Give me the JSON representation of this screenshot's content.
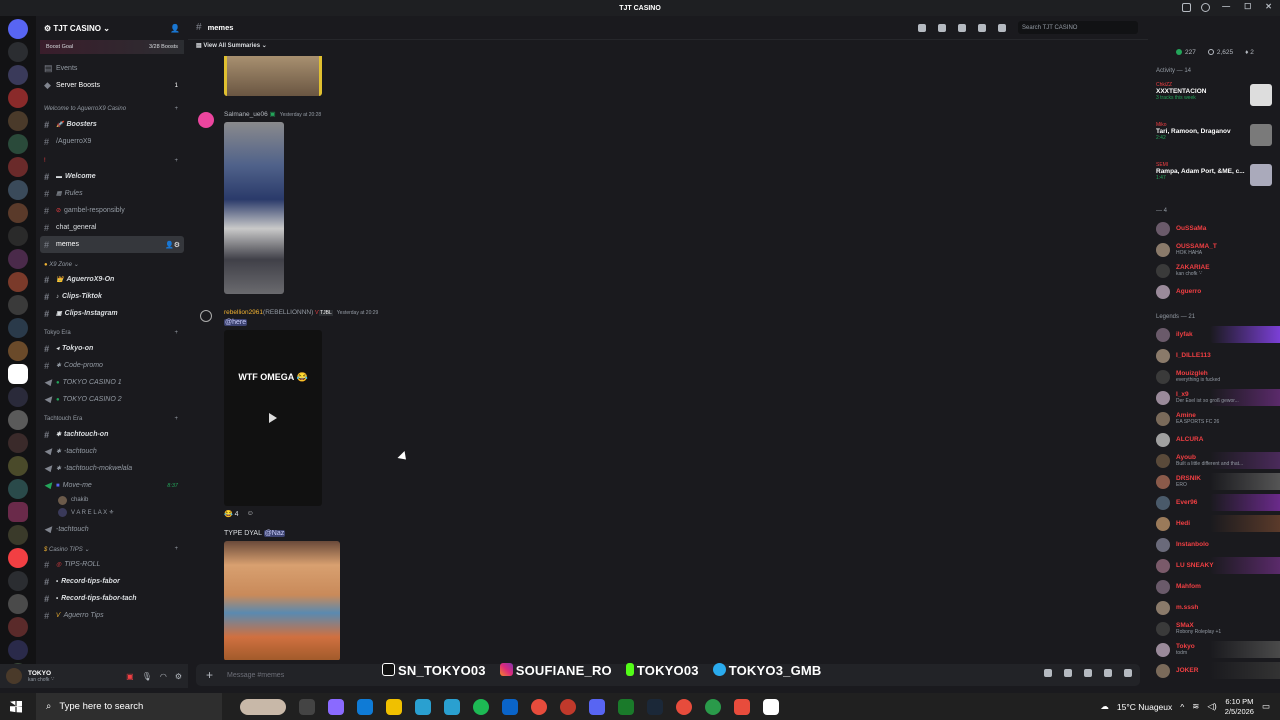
{
  "window": {
    "title": "TJT CASINO"
  },
  "server": {
    "name": "TJT CASINO",
    "boost_goal": "Boost Goal",
    "boost_count": "3/28 Boosts"
  },
  "channels": {
    "events": "Events",
    "server_boosts": "Server Boosts",
    "server_boosts_count": "1",
    "cat1": "Welcome to AguerroX9 Casino",
    "boosters": "Boosters",
    "aguerro": "/AguerroX9",
    "cat2": "!",
    "welcome": "Welcome",
    "rules": "Rules",
    "gambel": "gambel-responsibly",
    "chat_general": "chat_general",
    "memes": "memes",
    "cat3": "X9 Zone",
    "aguerro_on": "AguerroX9-On",
    "clips_tiktok": "Clips-Tiktok",
    "clips_instagram": "Clips-Instagram",
    "cat4": "Tokyo Era",
    "tokyo_on": "Tokyo-on",
    "code_promo": "Code-promo",
    "tokyo_casino1": "TOKYO CASINO 1",
    "tokyo_casino2": "TOKYO CASINO 2",
    "cat5": "Tachtouch Era",
    "tachtouch_on": "tachtouch-on",
    "tachtouch": "-tachtouch",
    "tachtouch_mok": "-tachtouch-mokwelala",
    "move_me": "Move-me",
    "move_me_time": "8:37",
    "vc_user1": "chakib",
    "vc_user2": "V A R E L A X ⚜",
    "tachtouch2": "-tachtouch",
    "cat6": "Casino TIPS",
    "tips_roll": "TIPS-ROLL",
    "record_fabor": "Record-tips-fabor",
    "record_fabor_tach": "Record-tips-fabor-tach",
    "aguerro_tips": "Aguerro Tips"
  },
  "user": {
    "name": "TOKYO",
    "status": "kan chofk '-'"
  },
  "channel_header": {
    "name": "memes",
    "search_placeholder": "Search TJT CASINO"
  },
  "summaries": "View All Summaries",
  "messages": [
    {
      "author": "Salmane_ue06",
      "time": "Yesterday at 20:28"
    },
    {
      "author": "rebellion2961",
      "alias": "(REBELLIONNN)",
      "tag": "TJBL",
      "time": "Yesterday at 20:29",
      "mention": "@here",
      "video_text": "WTF OMEGA 😂",
      "reaction_count": "4"
    },
    {
      "text": "TYPE DYAL",
      "mention": "@Naz"
    }
  ],
  "composer": {
    "placeholder": "Message #memes"
  },
  "overlay": {
    "tiktok": "SN_TOKYO03",
    "instagram": "SOUFIANE_RO",
    "kick": "TOKYO03",
    "telegram": "TOKYO3_GMB"
  },
  "right": {
    "online": "227",
    "members": "2,625",
    "boosts": "2",
    "activity_title": "Activity — 14",
    "activities": [
      {
        "who": "ChkiZZ",
        "title": "XXXTENTACION",
        "sub": "3 tracks this week"
      },
      {
        "who": "Miko",
        "title": "Tari, Ramoon, Draganov",
        "sub": "2:42"
      },
      {
        "who": "SEMI",
        "title": "Rampa, Adam Port, &ME, c...",
        "sub": "1:47"
      }
    ],
    "section1": "— 4",
    "members_top": [
      {
        "name": "OuSSaMa",
        "color": "#f23f43"
      },
      {
        "name": "OUSSAMA_T",
        "color": "#f23f43",
        "status": "HOK HAHA"
      },
      {
        "name": "ZAKARIAE",
        "color": "#f23f43",
        "status": "kan chofk '-'"
      },
      {
        "name": "Aguerro",
        "color": "#f23f43"
      }
    ],
    "legends_title": "Legends — 21",
    "legends": [
      {
        "name": "ilyfak",
        "color": "#f23f43",
        "bar": "#7b3fd6"
      },
      {
        "name": "I_DILLE113",
        "color": "#f23f43"
      },
      {
        "name": "Mouizgleh",
        "color": "#f23f43",
        "status": "everything is fucked"
      },
      {
        "name": "I_x9",
        "color": "#f23f43",
        "status": "Der Esel ist so groß gewor...",
        "bar": "#5a2a6a"
      },
      {
        "name": "Amine",
        "color": "#f23f43",
        "status": "EA SPORTS FC 26"
      },
      {
        "name": "ALCURA",
        "color": "#f23f43"
      },
      {
        "name": "Ayoub",
        "color": "#f23f43",
        "status": "Built a little different and that...",
        "bar": "#4a2a5a"
      },
      {
        "name": "DRSNIK",
        "color": "#f23f43",
        "status": "ERO",
        "bar": "#555"
      },
      {
        "name": "Ever96",
        "color": "#f23f43",
        "bar": "#6a2a8a"
      },
      {
        "name": "Hedi",
        "color": "#f23f43",
        "bar": "#5a3a2a"
      },
      {
        "name": "Instanbolo",
        "color": "#f23f43"
      },
      {
        "name": "LU SNEAKY",
        "color": "#f23f43",
        "bar": "#5a2a6a"
      },
      {
        "name": "Mahfom",
        "color": "#f23f43"
      },
      {
        "name": "m.sssh",
        "color": "#f23f43"
      },
      {
        "name": "SMaX",
        "color": "#f23f43",
        "status": "Robony Roleplay +1"
      },
      {
        "name": "Tokyo",
        "color": "#f23f43",
        "status": "todm",
        "bar": "#4a4a4a"
      },
      {
        "name": "JOKER",
        "color": "#f23f43",
        "bar": "#333"
      }
    ]
  },
  "taskbar": {
    "search": "Type here to search",
    "weather": "15°C  Nuageux",
    "time": "6:10 PM",
    "date": "2/5/2026"
  }
}
